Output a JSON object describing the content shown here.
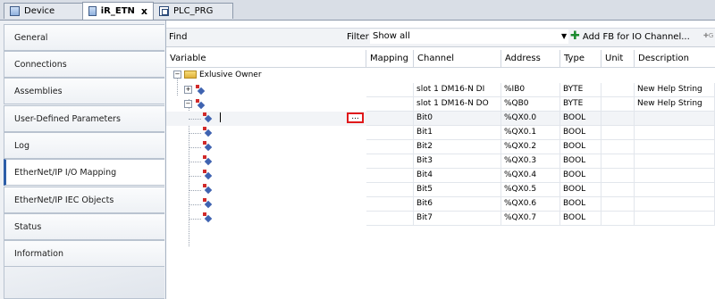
{
  "tabs": [
    {
      "label": "Device",
      "icon": "device-icon",
      "active": false
    },
    {
      "label": "iR_ETN",
      "icon": "device-icon",
      "active": true,
      "close": "x"
    },
    {
      "label": "PLC_PRG",
      "icon": "program-icon",
      "active": false
    }
  ],
  "nav": {
    "items": [
      "General",
      "Connections",
      "Assemblies",
      "User-Defined Parameters",
      "Log",
      "EtherNet/IP I/O Mapping",
      "EtherNet/IP IEC Objects",
      "Status",
      "Information"
    ],
    "active_index": 5
  },
  "toolbar": {
    "find_label": "Find",
    "filter_label": "Filter",
    "filter_value": "Show all",
    "add_fb_label": "Add FB for IO Channel...",
    "goto_label": "G"
  },
  "grid": {
    "columns": [
      "Variable",
      "Mapping",
      "Channel",
      "Address",
      "Type",
      "Unit",
      "Description"
    ],
    "group_label": "Exlusive Owner",
    "rows": [
      {
        "level": 1,
        "channel": "slot 1 DM16-N DI",
        "address": "%IB0",
        "type": "BYTE",
        "description": "New Help String",
        "expander": "+"
      },
      {
        "level": 1,
        "channel": "slot 1 DM16-N DO",
        "address": "%QB0",
        "type": "BYTE",
        "description": "New Help String",
        "expander": "-"
      },
      {
        "level": 2,
        "channel": "Bit0",
        "address": "%QX0.0",
        "type": "BOOL",
        "description": "",
        "editing": true,
        "ellipsis": "..."
      },
      {
        "level": 2,
        "channel": "Bit1",
        "address": "%QX0.1",
        "type": "BOOL",
        "description": ""
      },
      {
        "level": 2,
        "channel": "Bit2",
        "address": "%QX0.2",
        "type": "BOOL",
        "description": ""
      },
      {
        "level": 2,
        "channel": "Bit3",
        "address": "%QX0.3",
        "type": "BOOL",
        "description": ""
      },
      {
        "level": 2,
        "channel": "Bit4",
        "address": "%QX0.4",
        "type": "BOOL",
        "description": ""
      },
      {
        "level": 2,
        "channel": "Bit5",
        "address": "%QX0.5",
        "type": "BOOL",
        "description": ""
      },
      {
        "level": 2,
        "channel": "Bit6",
        "address": "%QX0.6",
        "type": "BOOL",
        "description": ""
      },
      {
        "level": 2,
        "channel": "Bit7",
        "address": "%QX0.7",
        "type": "BOOL",
        "description": ""
      }
    ]
  },
  "colors": {
    "accent": "#2d5ea8",
    "highlight_box": "#e0191b",
    "io_icon_red": "#d12b2b",
    "io_icon_blue": "#3f63b0"
  }
}
